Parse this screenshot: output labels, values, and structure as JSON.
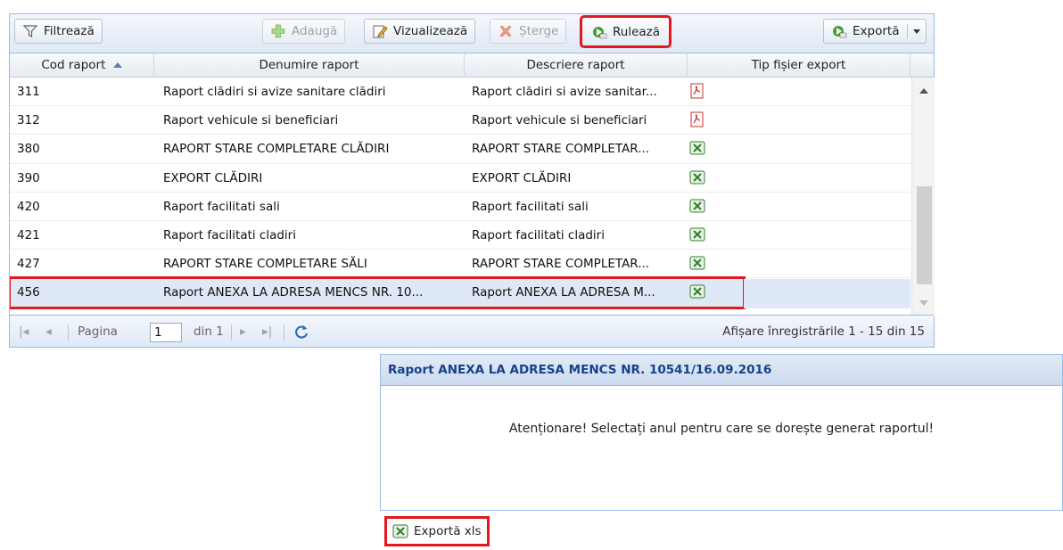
{
  "toolbar": {
    "filter_label": "Filtrează",
    "add_label": "Adaugă",
    "view_label": "Vizualizează",
    "delete_label": "Șterge",
    "run_label": "Rulează",
    "export_label": "Exportă"
  },
  "grid": {
    "columns": [
      "Cod raport",
      "Denumire raport",
      "Descriere raport",
      "Tip fișier export"
    ],
    "sort_column": "Cod raport",
    "sort_direction": "asc",
    "rows": [
      {
        "code": "311",
        "name": "Raport clădiri si avize sanitare clădiri",
        "desc": "Raport clădiri si avize sanitar...",
        "type": "pdf-icon"
      },
      {
        "code": "312",
        "name": "Raport vehicule si beneficiari",
        "desc": "Raport vehicule si beneficiari",
        "type": "pdf-icon"
      },
      {
        "code": "380",
        "name": "RAPORT STARE COMPLETARE CLĂDIRI",
        "desc": "RAPORT STARE COMPLETAR...",
        "type": "excel-icon"
      },
      {
        "code": "390",
        "name": "EXPORT CLĂDIRI",
        "desc": "EXPORT CLĂDIRI",
        "type": "excel-icon"
      },
      {
        "code": "420",
        "name": "Raport facilitati sali",
        "desc": "Raport facilitati sali",
        "type": "excel-icon"
      },
      {
        "code": "421",
        "name": "Raport facilitati cladiri",
        "desc": "Raport facilitati cladiri",
        "type": "excel-icon"
      },
      {
        "code": "427",
        "name": "RAPORT STARE COMPLETARE SĂLI",
        "desc": "RAPORT STARE COMPLETAR...",
        "type": "excel-icon"
      },
      {
        "code": "456",
        "name": "Raport ANEXA LA ADRESA MENCS NR. 10...",
        "desc": "Raport ANEXA LA ADRESA M...",
        "type": "excel-icon",
        "selected": true
      }
    ]
  },
  "pager": {
    "page_label": "Pagina",
    "page_value": "1",
    "of_label": "din 1",
    "display_info": "Afișare înregistrările 1 - 15 din 15"
  },
  "dialog": {
    "title": "Raport ANEXA LA ADRESA MENCS NR. 10541/16.09.2016",
    "message": "Atenționare! Selectați anul pentru care se dorește generat raportul!",
    "export_xls_label": "Exportă xls"
  },
  "colors": {
    "highlight": "#e3171f",
    "header_blue": "#15428b",
    "border_blue": "#99bbe8"
  }
}
